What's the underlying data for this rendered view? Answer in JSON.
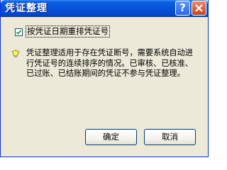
{
  "window": {
    "title": "凭证整理"
  },
  "titlebar": {
    "help_glyph": "?",
    "close_icon": "close-icon"
  },
  "option": {
    "label": "按凭证日期重排凭证号",
    "checked": true
  },
  "info": {
    "icon": "lightbulb-icon",
    "text": "凭证整理适用于存在凭证断号，需要系统自动进行凭证号的连续排序的情况。已审核、已核准、已过账、已结账期间的凭证不参与凭证整理。"
  },
  "buttons": {
    "ok_label": "确定",
    "cancel_label": "取消"
  },
  "colors": {
    "titlebar": "#0752d8",
    "dialog_bg": "#ece9d8",
    "close_button": "#c8421c"
  }
}
